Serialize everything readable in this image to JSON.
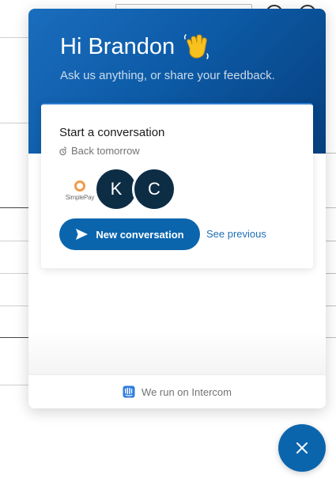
{
  "messenger": {
    "greeting": "Hi Brandon",
    "intro": "Ask us anything, or share your feedback.",
    "card": {
      "title": "Start a conversation",
      "reply_time": "Back tomorrow",
      "team": [
        {
          "type": "logo",
          "label": "SimplePay"
        },
        {
          "type": "initial",
          "label": "K"
        },
        {
          "type": "initial",
          "label": "C"
        }
      ],
      "new_conversation_label": "New conversation",
      "see_previous_label": "See previous"
    },
    "footer_label": "We run on Intercom"
  },
  "colors": {
    "brand_blue": "#0b65ad",
    "header_gradient_start": "#1a6dbd",
    "header_gradient_end": "#063f7e",
    "avatar_dark": "#0d2d45",
    "link_blue": "#1f6fb5",
    "logo_orange": "#f29a4a"
  },
  "icons": {
    "greeting_emoji": "waving-hand-icon",
    "reply_time": "clock-icon",
    "new_conversation": "send-icon",
    "footer": "intercom-icon",
    "launcher": "close-icon"
  }
}
